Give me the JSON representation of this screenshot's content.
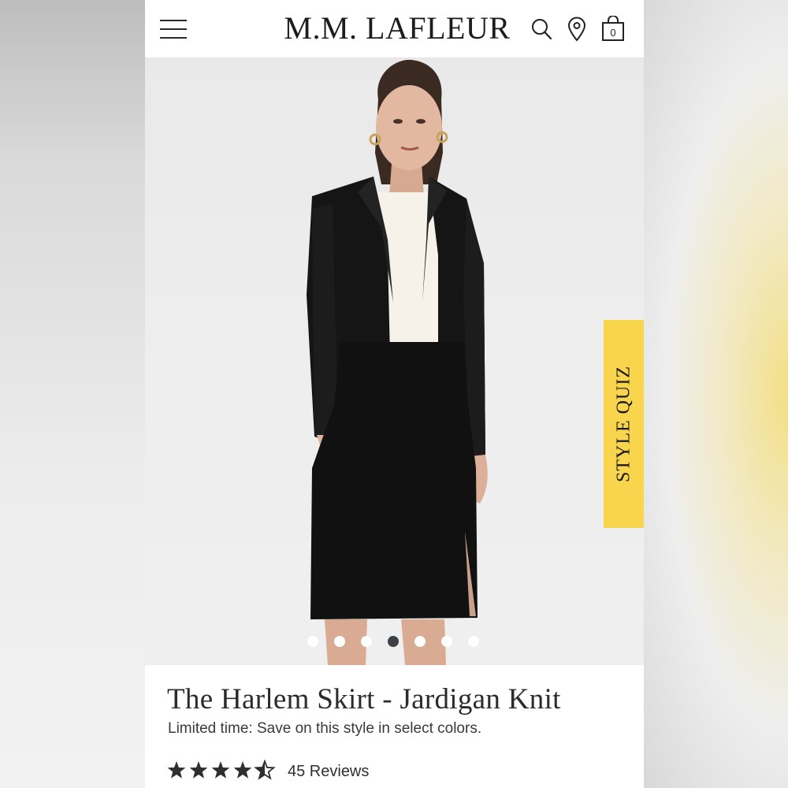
{
  "brand": {
    "logo_text": "M.M. LAFLEUR"
  },
  "header": {
    "menu_icon": "hamburger-menu-icon",
    "search_icon": "search-icon",
    "location_icon": "location-pin-icon",
    "bag_icon": "shopping-bag-icon",
    "bag_count": "0"
  },
  "carousel": {
    "slide_count": 7,
    "active_index": 3
  },
  "style_quiz": {
    "label": "STYLE QUIZ",
    "color": "#f9d54d"
  },
  "product": {
    "title": "The Harlem Skirt - Jardigan Knit",
    "promo": "Limited time: Save on this style in select colors.",
    "rating": 4.5,
    "rating_max": 5,
    "reviews_label": "45 Reviews"
  },
  "colors": {
    "text_dark": "#2b2b2b",
    "dot_active": "#3d4046",
    "star": "#2f2f2f"
  }
}
